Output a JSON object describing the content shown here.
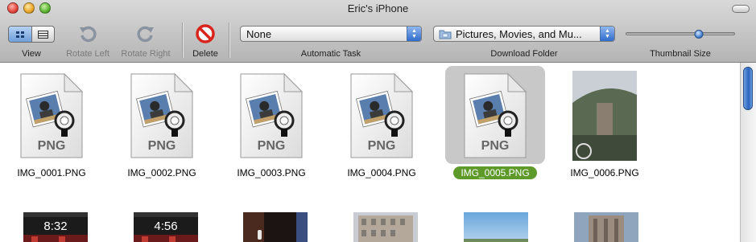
{
  "window": {
    "title": "Eric's iPhone"
  },
  "toolbar": {
    "view_label": "View",
    "rotate_left_label": "Rotate Left",
    "rotate_right_label": "Rotate Right",
    "delete_label": "Delete",
    "automatic_task": {
      "value": "None",
      "label": "Automatic Task"
    },
    "download_folder": {
      "value": "Pictures, Movies, and Mu...",
      "label": "Download Folder"
    },
    "thumbnail_size": {
      "label": "Thumbnail Size",
      "value_fraction": 0.67
    }
  },
  "items": [
    {
      "name": "IMG_0001.PNG",
      "kind": "png",
      "file_type": "PNG",
      "selected": false
    },
    {
      "name": "IMG_0002.PNG",
      "kind": "png",
      "file_type": "PNG",
      "selected": false
    },
    {
      "name": "IMG_0003.PNG",
      "kind": "png",
      "file_type": "PNG",
      "selected": false
    },
    {
      "name": "IMG_0004.PNG",
      "kind": "png",
      "file_type": "PNG",
      "selected": false
    },
    {
      "name": "IMG_0005.PNG",
      "kind": "png",
      "file_type": "PNG",
      "selected": true
    },
    {
      "name": "IMG_0006.PNG",
      "kind": "photo",
      "selected": false
    }
  ],
  "row2": [
    {
      "kind": "lockscreen",
      "time": "8:32"
    },
    {
      "kind": "lockscreen",
      "time": "4:56"
    },
    {
      "kind": "dark-photo"
    },
    {
      "kind": "building-photo"
    },
    {
      "kind": "sky-photo"
    },
    {
      "kind": "tower-photo"
    }
  ],
  "colors": {
    "selection_green": "#5d9a2a",
    "accent_blue": "#2f6ccc",
    "delete_red": "#d9241c"
  }
}
